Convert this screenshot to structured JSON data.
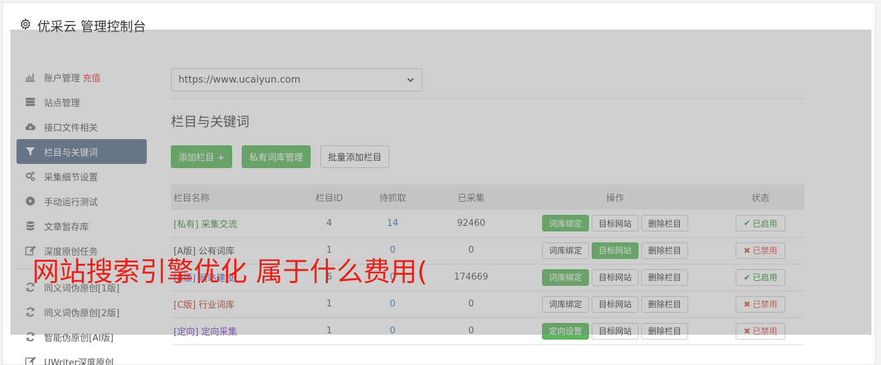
{
  "app": {
    "title": "优采云 管理控制台"
  },
  "sidebar": {
    "items": [
      {
        "label": "账户管理",
        "extra": "充值",
        "icon": "bar-chart-icon"
      },
      {
        "label": "站点管理",
        "icon": "server-icon"
      },
      {
        "label": "接口文件相关",
        "icon": "cloud-upload-icon"
      },
      {
        "label": "栏目与关键词",
        "icon": "filter-icon",
        "active": true
      },
      {
        "label": "采集细节设置",
        "icon": "gears-icon"
      },
      {
        "label": "手动运行测试",
        "icon": "play-circle-icon"
      },
      {
        "label": "文章暂存库",
        "icon": "database-icon"
      },
      {
        "label": "深度原创任务",
        "icon": "edit-icon"
      }
    ],
    "items2": [
      {
        "label": "同义词伪原创[1版]",
        "icon": "refresh-icon"
      },
      {
        "label": "同义词伪原创[2版]",
        "icon": "refresh-icon"
      },
      {
        "label": "智能伪原创[AI版]",
        "icon": "refresh-icon"
      },
      {
        "label": "UWriter深度原创",
        "icon": "edit-icon"
      }
    ]
  },
  "main": {
    "site_select": "https://www.ucaiyun.com",
    "section_title": "栏目与关键词",
    "buttons": {
      "add_column": "添加栏目 +",
      "private_lexicon": "私有词库管理",
      "batch_add": "批量添加栏目"
    },
    "table": {
      "headers": [
        "栏目名称",
        "栏目ID",
        "待抓取",
        "已采集",
        "操作",
        "状态"
      ],
      "rows": [
        {
          "tag": "[私有]",
          "name": "采集交流",
          "tagClass": "tag-green",
          "id": "4",
          "pending": "14",
          "collected": "92460",
          "op1": "词库绑定",
          "op1on": true,
          "op2": "目标网站",
          "op2on": false,
          "op3": "删除栏目",
          "status": "已启用",
          "enabled": true
        },
        {
          "tag": "[A版]",
          "name": "公有词库",
          "tagClass": "tag-dark",
          "id": "1",
          "pending": "0",
          "collected": "0",
          "op1": "词库绑定",
          "op1on": false,
          "op2": "目标网站",
          "op2on": true,
          "op3": "删除栏目",
          "status": "已禁用",
          "enabled": false
        },
        {
          "tag": "[B版]",
          "name": "网站建设",
          "tagClass": "tag-blue",
          "id": "6",
          "pending": "0",
          "collected": "174669",
          "op1": "词库绑定",
          "op1on": true,
          "op2": "目标网站",
          "op2on": false,
          "op3": "删除栏目",
          "status": "已启用",
          "enabled": true
        },
        {
          "tag": "[C版]",
          "name": "行业词库",
          "tagClass": "tag-red",
          "id": "1",
          "pending": "0",
          "collected": "0",
          "op1": "词库绑定",
          "op1on": false,
          "op2": "目标网站",
          "op2on": false,
          "op3": "删除栏目",
          "status": "已禁用",
          "enabled": false
        },
        {
          "tag": "[定向]",
          "name": "定向采集",
          "tagClass": "tag-purple",
          "id": "1",
          "pending": "0",
          "collected": "0",
          "op1": "定向设置",
          "op1on": true,
          "op2": "目标网站",
          "op2on": false,
          "op3": "删除栏目",
          "status": "已禁用",
          "enabled": false
        }
      ]
    }
  },
  "watermark": "网站搜索引擎优化 属于什么费用(",
  "colors": {
    "accent_green": "#5cb85c",
    "active_nav": "#5a6e8c",
    "danger": "#d9534f",
    "watermark": "#e8201a"
  }
}
